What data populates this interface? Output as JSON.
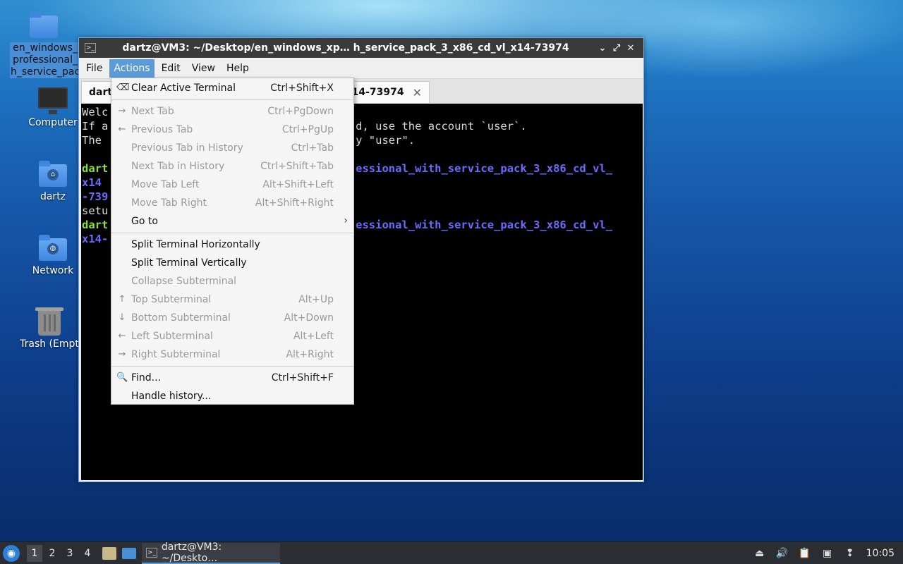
{
  "desktop": {
    "icons": [
      {
        "label": "en_windows_professional_h_service_pac",
        "lines": [
          "en_windows_",
          "professional_",
          "h_service_pac"
        ],
        "icon": "folder-icon"
      },
      {
        "label": "Computer",
        "icon": "computer-icon"
      },
      {
        "label": "dartz",
        "icon": "home-folder-icon"
      },
      {
        "label": "Network",
        "icon": "network-folder-icon"
      },
      {
        "label": "Trash (Empt",
        "icon": "trash-icon"
      }
    ]
  },
  "window": {
    "title": "dartz@VM3: ~/Desktop/en_windows_xp… h_service_pack_3_x86_cd_vl_x14-73974",
    "controls": {
      "minimize": "⌄",
      "maximize": "⤢",
      "close": "✕"
    },
    "menubar": [
      "File",
      "Actions",
      "Edit",
      "View",
      "Help"
    ],
    "active_menu": "Actions",
    "tab": {
      "label_left": "dart",
      "label_right": "_x14-73974",
      "close": "✕"
    },
    "terminal_lines": [
      {
        "left": "Welc",
        "right": ""
      },
      {
        "left": "If a",
        "right": "d, use the account `user`."
      },
      {
        "left": "The ",
        "right": "y \"user\"."
      },
      {
        "left": "",
        "right": ""
      },
      {
        "left": "dart",
        "right": "essional_with_service_pack_3_x86_cd_vl_",
        "style": "prompt"
      },
      {
        "left": "x14",
        "right": "",
        "style": "blue"
      },
      {
        "left": "-739",
        "right": "",
        "style": "blue"
      },
      {
        "left": "setu",
        "right": ""
      },
      {
        "left": "dart",
        "right": "essional_with_service_pack_3_x86_cd_vl_",
        "style": "prompt"
      },
      {
        "left": "x14-",
        "right": "",
        "style": "blue"
      }
    ]
  },
  "actions_menu": {
    "groups": [
      [
        {
          "label": "Clear Active Terminal",
          "accel": "Ctrl+Shift+X",
          "icon": "clear-terminal-icon",
          "glyph": "⌫",
          "enabled": true
        }
      ],
      [
        {
          "label": "Next Tab",
          "accel": "Ctrl+PgDown",
          "icon": "arrow-right-icon",
          "glyph": "→",
          "enabled": false
        },
        {
          "label": "Previous Tab",
          "accel": "Ctrl+PgUp",
          "icon": "arrow-left-icon",
          "glyph": "←",
          "enabled": false
        },
        {
          "label": "Previous Tab in History",
          "accel": "Ctrl+Tab",
          "icon": "",
          "glyph": "",
          "enabled": false
        },
        {
          "label": "Next Tab in History",
          "accel": "Ctrl+Shift+Tab",
          "icon": "",
          "glyph": "",
          "enabled": false
        },
        {
          "label": "Move Tab Left",
          "accel": "Alt+Shift+Left",
          "icon": "",
          "glyph": "",
          "enabled": false
        },
        {
          "label": "Move Tab Right",
          "accel": "Alt+Shift+Right",
          "icon": "",
          "glyph": "",
          "enabled": false
        },
        {
          "label": "Go to",
          "accel": "",
          "icon": "",
          "glyph": "",
          "enabled": true,
          "submenu": "›"
        }
      ],
      [
        {
          "label": "Split Terminal Horizontally",
          "accel": "",
          "icon": "",
          "glyph": "",
          "enabled": true
        },
        {
          "label": "Split Terminal Vertically",
          "accel": "",
          "icon": "",
          "glyph": "",
          "enabled": true
        },
        {
          "label": "Collapse Subterminal",
          "accel": "",
          "icon": "",
          "glyph": "",
          "enabled": false
        },
        {
          "label": "Top Subterminal",
          "accel": "Alt+Up",
          "icon": "arrow-up-icon",
          "glyph": "↑",
          "enabled": false
        },
        {
          "label": "Bottom Subterminal",
          "accel": "Alt+Down",
          "icon": "arrow-down-icon",
          "glyph": "↓",
          "enabled": false
        },
        {
          "label": "Left Subterminal",
          "accel": "Alt+Left",
          "icon": "arrow-left-icon",
          "glyph": "←",
          "enabled": false
        },
        {
          "label": "Right Subterminal",
          "accel": "Alt+Right",
          "icon": "arrow-right-icon",
          "glyph": "→",
          "enabled": false
        }
      ],
      [
        {
          "label": "Find...",
          "accel": "Ctrl+Shift+F",
          "icon": "search-icon",
          "glyph": "🔍",
          "enabled": true
        },
        {
          "label": "Handle history...",
          "accel": "",
          "icon": "",
          "glyph": "",
          "enabled": true
        }
      ]
    ]
  },
  "taskbar": {
    "workspaces": [
      "1",
      "2",
      "3",
      "4"
    ],
    "active_workspace": "1",
    "task_label": "dartz@VM3: ~/Deskto…",
    "clock": "10:05"
  }
}
